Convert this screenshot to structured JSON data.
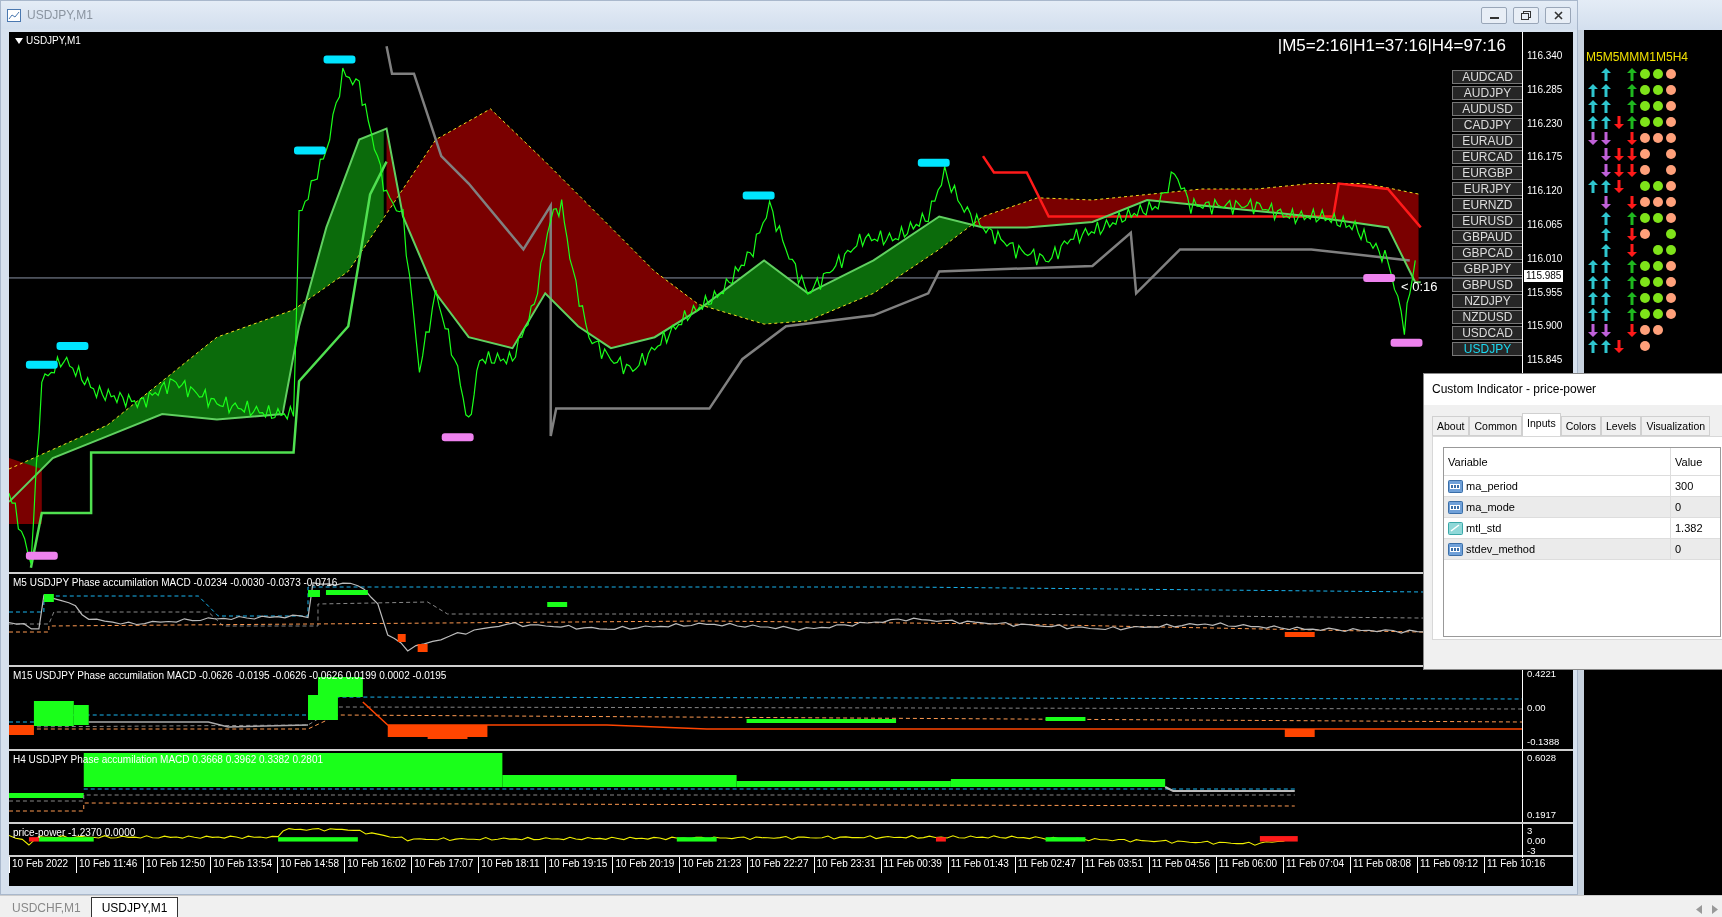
{
  "window": {
    "title": "USDJPY,M1"
  },
  "chart": {
    "symbol": "USDJPY,M1",
    "countdown": "|M5=2:16|H1=37:16|H4=97:16",
    "timer": "< 0:16",
    "current_price": "115.985",
    "price_axis": [
      "116.340",
      "116.285",
      "116.230",
      "116.175",
      "116.120",
      "116.065",
      "116.010",
      "115.955",
      "115.900",
      "115.845"
    ],
    "symbols": [
      {
        "label": "AUDCAD",
        "selected": false
      },
      {
        "label": "AUDJPY",
        "selected": false
      },
      {
        "label": "AUDUSD",
        "selected": false
      },
      {
        "label": "CADJPY",
        "selected": false
      },
      {
        "label": "EURAUD",
        "selected": false
      },
      {
        "label": "EURCAD",
        "selected": false
      },
      {
        "label": "EURGBP",
        "selected": false
      },
      {
        "label": "EURJPY",
        "selected": false
      },
      {
        "label": "EURNZD",
        "selected": false
      },
      {
        "label": "EURUSD",
        "selected": false
      },
      {
        "label": "GBPAUD",
        "selected": false
      },
      {
        "label": "GBPCAD",
        "selected": false
      },
      {
        "label": "GBPJPY",
        "selected": false
      },
      {
        "label": "GBPUSD",
        "selected": false
      },
      {
        "label": "NZDJPY",
        "selected": false
      },
      {
        "label": "NZDUSD",
        "selected": false
      },
      {
        "label": "USDCAD",
        "selected": false
      },
      {
        "label": "USDJPY",
        "selected": true
      }
    ]
  },
  "subwindows": [
    {
      "label": "M5 USDJPY Phase accumilation MACD -0.0234 -0.0030 -0.0373 -0.0716"
    },
    {
      "label": "M15 USDJPY Phase accumilation MACD -0.0626 -0.0195 -0.0626 -0.0626 0.0199 0.0002 -0.0195",
      "axis": [
        "0.4221",
        "0.00",
        "-0.1388"
      ]
    },
    {
      "label": "H4 USDJPY Phase accumilation MACD 0.3668 0.3962 0.3382 0.2801",
      "axis": [
        "0.6028",
        "0.1917"
      ]
    },
    {
      "label": "price-power -1.2370 0.0000",
      "axis": [
        "3",
        "0.00",
        "-3"
      ]
    }
  ],
  "time_axis": [
    "10 Feb 2022",
    "10 Feb 11:46",
    "10 Feb 12:50",
    "10 Feb 13:54",
    "10 Feb 14:58",
    "10 Feb 16:02",
    "10 Feb 17:07",
    "10 Feb 18:11",
    "10 Feb 19:15",
    "10 Feb 20:19",
    "10 Feb 21:23",
    "10 Feb 22:27",
    "10 Feb 23:31",
    "11 Feb 00:39",
    "11 Feb 01:43",
    "11 Feb 02:47",
    "11 Feb 03:51",
    "11 Feb 04:56",
    "11 Feb 06:00",
    "11 Feb 07:04",
    "11 Feb 08:08",
    "11 Feb 09:12",
    "11 Feb 10:16"
  ],
  "signal_panel": {
    "header": "M5M5MMM1M5H4",
    "rows": [
      {
        "arrows": [
          {
            "kind": "none"
          },
          {
            "kind": "up"
          },
          {
            "kind": "none"
          },
          {
            "kind": "up"
          }
        ],
        "dots": [
          {
            "kind": "bull"
          },
          {
            "kind": "bull"
          },
          {
            "kind": "bear"
          }
        ]
      },
      {
        "arrows": [
          {
            "kind": "up"
          },
          {
            "kind": "up"
          },
          {
            "kind": "none"
          },
          {
            "kind": "up"
          }
        ],
        "dots": [
          {
            "kind": "bull"
          },
          {
            "kind": "bull"
          },
          {
            "kind": "bear"
          }
        ]
      },
      {
        "arrows": [
          {
            "kind": "up"
          },
          {
            "kind": "up"
          },
          {
            "kind": "none"
          },
          {
            "kind": "up"
          }
        ],
        "dots": [
          {
            "kind": "bull"
          },
          {
            "kind": "bull"
          },
          {
            "kind": "bear"
          }
        ]
      },
      {
        "arrows": [
          {
            "kind": "up"
          },
          {
            "kind": "up"
          },
          {
            "kind": "down"
          },
          {
            "kind": "up"
          }
        ],
        "dots": [
          {
            "kind": "bull"
          },
          {
            "kind": "bull"
          },
          {
            "kind": "bear"
          }
        ]
      },
      {
        "arrows": [
          {
            "kind": "down"
          },
          {
            "kind": "down"
          },
          {
            "kind": "none"
          },
          {
            "kind": "down"
          }
        ],
        "dots": [
          {
            "kind": "bear"
          },
          {
            "kind": "bear"
          },
          {
            "kind": "bear"
          }
        ]
      },
      {
        "arrows": [
          {
            "kind": "none"
          },
          {
            "kind": "down"
          },
          {
            "kind": "down"
          },
          {
            "kind": "down"
          }
        ],
        "dots": [
          {
            "kind": "bear"
          },
          {
            "kind": "none"
          },
          {
            "kind": "bear"
          }
        ]
      },
      {
        "arrows": [
          {
            "kind": "none"
          },
          {
            "kind": "down"
          },
          {
            "kind": "down"
          },
          {
            "kind": "down"
          }
        ],
        "dots": [
          {
            "kind": "bear"
          },
          {
            "kind": "none"
          },
          {
            "kind": "bear"
          }
        ]
      },
      {
        "arrows": [
          {
            "kind": "up"
          },
          {
            "kind": "up"
          },
          {
            "kind": "down"
          },
          {
            "kind": "none"
          }
        ],
        "dots": [
          {
            "kind": "bull"
          },
          {
            "kind": "bull"
          },
          {
            "kind": "bear"
          }
        ]
      },
      {
        "arrows": [
          {
            "kind": "none"
          },
          {
            "kind": "down"
          },
          {
            "kind": "none"
          },
          {
            "kind": "down"
          }
        ],
        "dots": [
          {
            "kind": "bear"
          },
          {
            "kind": "bear"
          },
          {
            "kind": "bear"
          }
        ]
      },
      {
        "arrows": [
          {
            "kind": "none"
          },
          {
            "kind": "up"
          },
          {
            "kind": "none"
          },
          {
            "kind": "up"
          }
        ],
        "dots": [
          {
            "kind": "bull"
          },
          {
            "kind": "bull"
          },
          {
            "kind": "bear"
          }
        ]
      },
      {
        "arrows": [
          {
            "kind": "none"
          },
          {
            "kind": "up"
          },
          {
            "kind": "none"
          },
          {
            "kind": "down"
          }
        ],
        "dots": [
          {
            "kind": "bear"
          },
          {
            "kind": "none"
          },
          {
            "kind": "bull"
          }
        ]
      },
      {
        "arrows": [
          {
            "kind": "none"
          },
          {
            "kind": "up"
          },
          {
            "kind": "none"
          },
          {
            "kind": "down"
          }
        ],
        "dots": [
          {
            "kind": "none"
          },
          {
            "kind": "bull"
          },
          {
            "kind": "bull"
          }
        ]
      },
      {
        "arrows": [
          {
            "kind": "up"
          },
          {
            "kind": "up"
          },
          {
            "kind": "none"
          },
          {
            "kind": "up"
          }
        ],
        "dots": [
          {
            "kind": "bull"
          },
          {
            "kind": "bull"
          },
          {
            "kind": "bear"
          }
        ]
      },
      {
        "arrows": [
          {
            "kind": "up"
          },
          {
            "kind": "up"
          },
          {
            "kind": "none"
          },
          {
            "kind": "up"
          }
        ],
        "dots": [
          {
            "kind": "bull"
          },
          {
            "kind": "bull"
          },
          {
            "kind": "bear"
          }
        ]
      },
      {
        "arrows": [
          {
            "kind": "up"
          },
          {
            "kind": "up"
          },
          {
            "kind": "none"
          },
          {
            "kind": "up"
          }
        ],
        "dots": [
          {
            "kind": "bull"
          },
          {
            "kind": "bull"
          },
          {
            "kind": "bear"
          }
        ]
      },
      {
        "arrows": [
          {
            "kind": "up"
          },
          {
            "kind": "up"
          },
          {
            "kind": "none"
          },
          {
            "kind": "up"
          }
        ],
        "dots": [
          {
            "kind": "bull"
          },
          {
            "kind": "bull"
          },
          {
            "kind": "bear"
          }
        ]
      },
      {
        "arrows": [
          {
            "kind": "down"
          },
          {
            "kind": "down"
          },
          {
            "kind": "none"
          },
          {
            "kind": "down"
          }
        ],
        "dots": [
          {
            "kind": "bear"
          },
          {
            "kind": "bear"
          },
          {
            "kind": "none"
          }
        ]
      },
      {
        "arrows": [
          {
            "kind": "up"
          },
          {
            "kind": "up"
          },
          {
            "kind": "down"
          },
          {
            "kind": "none"
          }
        ],
        "dots": [
          {
            "kind": "bear"
          },
          {
            "kind": "none"
          },
          {
            "kind": "none"
          }
        ]
      }
    ]
  },
  "dialog": {
    "title": "Custom Indicator - price-power",
    "tabs": [
      {
        "label": "About",
        "selected": false
      },
      {
        "label": "Common",
        "selected": false
      },
      {
        "label": "Inputs",
        "selected": true
      },
      {
        "label": "Colors",
        "selected": false
      },
      {
        "label": "Levels",
        "selected": false
      },
      {
        "label": "Visualization",
        "selected": false
      }
    ],
    "columns": [
      "Variable",
      "Value"
    ],
    "rows": [
      {
        "kind": "int",
        "variable": "ma_period",
        "value": "300"
      },
      {
        "kind": "int",
        "variable": "ma_mode",
        "value": "0"
      },
      {
        "kind": "double",
        "variable": "mtl_std",
        "value": "1.382"
      },
      {
        "kind": "int",
        "variable": "stdev_method",
        "value": "0"
      }
    ]
  },
  "chart_tabs": [
    {
      "label": "USDCHF,M1",
      "selected": false
    },
    {
      "label": "USDJPY,M1",
      "selected": true
    }
  ]
}
